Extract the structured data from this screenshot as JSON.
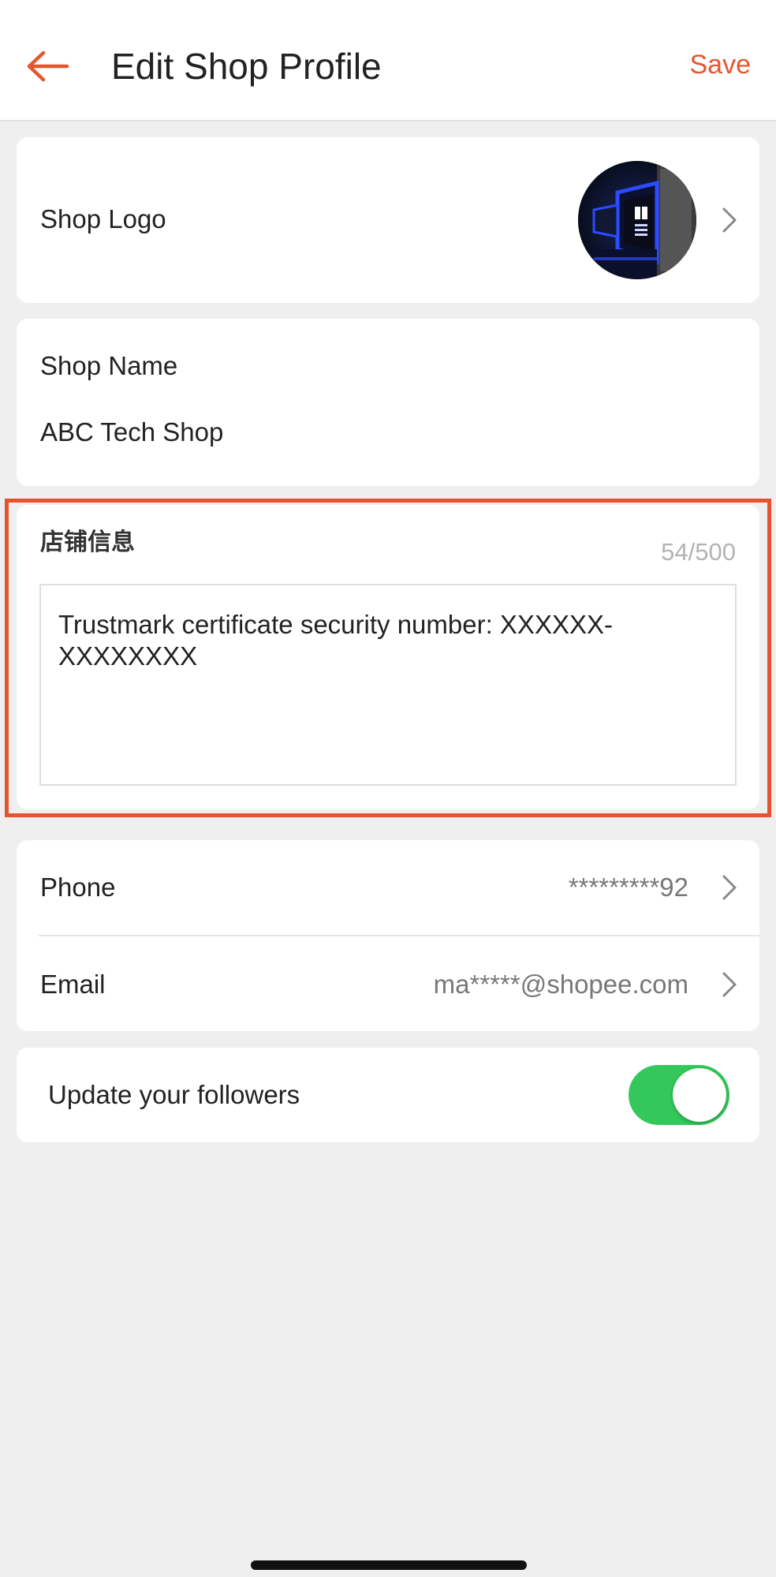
{
  "header": {
    "back_icon": "arrow-left-icon",
    "title": "Edit Shop Profile",
    "save_label": "Save"
  },
  "shop_logo": {
    "label": "Shop Logo",
    "image_icon": "shop-logo-image",
    "chevron_icon": "chevron-right-icon"
  },
  "shop_name": {
    "label": "Shop Name",
    "value": "ABC Tech Shop"
  },
  "shop_info": {
    "label": "店铺信息",
    "count": "54/500",
    "value": "Trustmark certificate security number: XXXXXX-XXXXXXXX"
  },
  "contact": {
    "phone_label": "Phone",
    "phone_value": "*********92",
    "email_label": "Email",
    "email_value": "ma*****@shopee.com",
    "chevron_icon": "chevron-right-icon"
  },
  "followers": {
    "label": "Update your followers",
    "toggle_on": true
  },
  "colors": {
    "accent": "#e4572e",
    "highlight": "#e4542f",
    "toggle_on": "#34c759",
    "background": "#efefef",
    "card": "#ffffff"
  }
}
